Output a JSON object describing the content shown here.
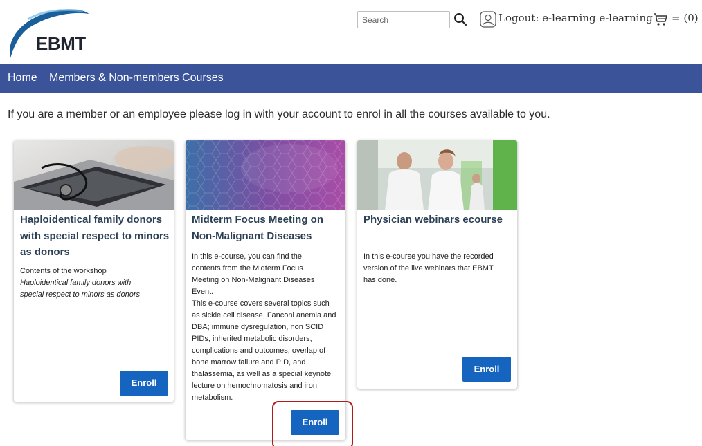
{
  "header": {
    "logo_text": "EBMT",
    "search": {
      "placeholder": "Search"
    },
    "logout_label": "Logout: e-learning e-learning",
    "cart_count_label": "= (0)"
  },
  "nav": {
    "items": [
      {
        "label": "Home"
      },
      {
        "label": "Members & Non-members Courses"
      }
    ]
  },
  "intro_text": "If you are a member or an employee please log in with your account to enrol in all the courses available to you.",
  "courses": [
    {
      "title_lines": [
        "Haploidentical family donors",
        "with special respect to minors",
        "as donors"
      ],
      "description_lines": [
        "Contents of the workshop"
      ],
      "description_italic_lines": [
        "Haploidentical family donors with",
        "special respect to minors as donors"
      ],
      "enroll_label": "Enroll"
    },
    {
      "title_lines": [
        "Midterm Focus Meeting on",
        "Non-Malignant Diseases"
      ],
      "description_lines": [
        "In this e-course, you can find the",
        "contents from the Midterm Focus",
        "Meeting on Non-Malignant Diseases",
        "Event.",
        "This e-course covers several topics such",
        "as sickle cell disease, Fanconi anemia and",
        "DBA; immune dysregulation, non SCID",
        "PIDs, inherited metabolic disorders,",
        "complications and outcomes, overlap of",
        "bone marrow failure and PID, and",
        "thalassemia, as well as a special keynote",
        "lecture on hemochromatosis and iron",
        "metabolism."
      ],
      "enroll_label": "Enroll"
    },
    {
      "title_lines": [
        "Physician webinars ecourse"
      ],
      "description_lines": [
        "In this e-course you have the recorded",
        "version of the live webinars that EBMT",
        "has done."
      ],
      "enroll_label": "Enroll"
    }
  ],
  "colors": {
    "nav_bg": "#3a5399",
    "button_bg": "#1565c0",
    "title_color": "#2b3f55",
    "highlight": "#b01c1c"
  },
  "icons": [
    "ebmt-logo",
    "search-icon",
    "user-icon",
    "cart-icon"
  ]
}
